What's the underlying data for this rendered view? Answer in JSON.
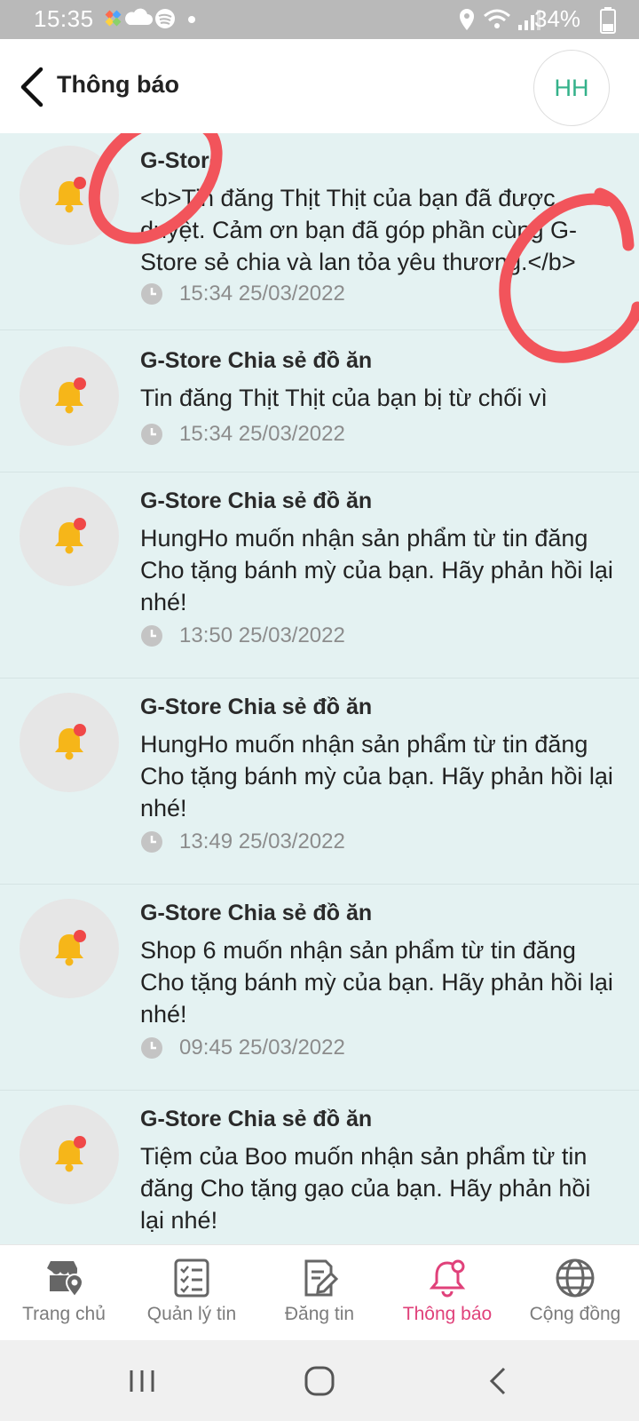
{
  "status_bar": {
    "time": "15:35",
    "battery": "34%"
  },
  "header": {
    "title": "Thông báo",
    "avatar_initials": "HH"
  },
  "notifications": [
    {
      "title": "G-Store",
      "body": "<b>Tin đăng Thịt Thịt của bạn đã được duyệt. Cảm ơn bạn đã góp phần cùng G-Store sẻ chia và lan tỏa yêu thương.</b>",
      "time": "15:34 25/03/2022"
    },
    {
      "title": "G-Store Chia sẻ đồ ăn",
      "body": "Tin đăng Thịt Thịt của bạn bị từ chối vì",
      "time": "15:34 25/03/2022"
    },
    {
      "title": "G-Store Chia sẻ đồ ăn",
      "body": "HungHo muốn nhận sản phẩm từ tin đăng Cho tặng bánh mỳ của bạn. Hãy phản hồi lại nhé!",
      "time": "13:50 25/03/2022"
    },
    {
      "title": "G-Store Chia sẻ đồ ăn",
      "body": "HungHo muốn nhận sản phẩm từ tin đăng Cho tặng bánh mỳ của bạn. Hãy phản hồi lại nhé!",
      "time": "13:49 25/03/2022"
    },
    {
      "title": "G-Store Chia sẻ đồ ăn",
      "body": "Shop 6 muốn nhận sản phẩm từ tin đăng Cho tặng bánh mỳ của bạn. Hãy phản hồi lại nhé!",
      "time": "09:45 25/03/2022"
    },
    {
      "title": "G-Store Chia sẻ đồ ăn",
      "body": "Tiệm của Boo muốn nhận sản phẩm từ tin đăng Cho tặng gạo của bạn. Hãy phản hồi lại nhé!",
      "time": ""
    }
  ],
  "bottom_nav": [
    {
      "label": "Trang chủ",
      "icon": "store-location-icon",
      "active": false
    },
    {
      "label": "Quản lý tin",
      "icon": "checklist-icon",
      "active": false
    },
    {
      "label": "Đăng tin",
      "icon": "edit-document-icon",
      "active": false
    },
    {
      "label": "Thông báo",
      "icon": "bell-icon",
      "active": true
    },
    {
      "label": "Cộng đồng",
      "icon": "globe-icon",
      "active": false
    }
  ],
  "colors": {
    "accent": "#e0417a",
    "avatar_text": "#34b18a",
    "list_bg": "#e4f2f2",
    "bell": "#f6b619",
    "badge": "#f04848",
    "annotation": "#f2545b"
  }
}
